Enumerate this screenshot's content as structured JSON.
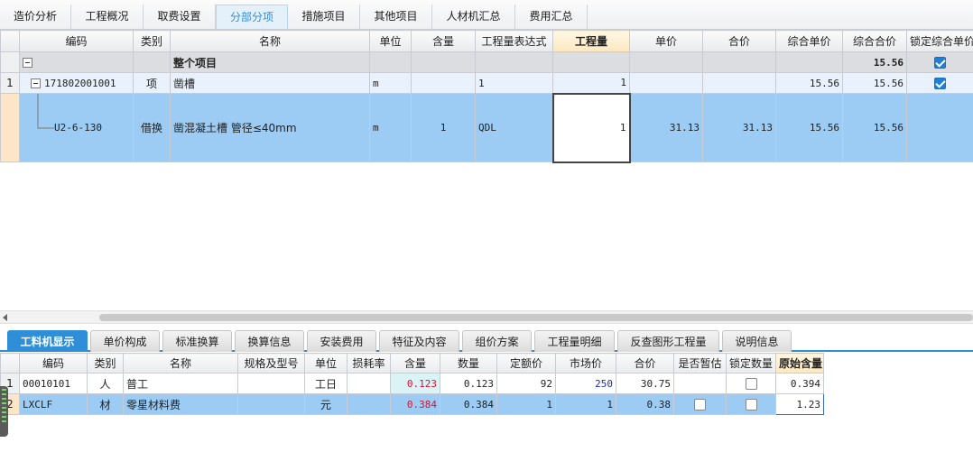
{
  "top_tabs": [
    "造价分析",
    "工程概况",
    "取费设置",
    "分部分项",
    "措施项目",
    "其他项目",
    "人材机汇总",
    "费用汇总"
  ],
  "active_top_tab": "分部分项",
  "main_grid": {
    "headers": [
      "编码",
      "类别",
      "名称",
      "单位",
      "含量",
      "工程量表达式",
      "工程量",
      "单价",
      "合价",
      "综合单价",
      "综合合价",
      "锁定综合单价"
    ],
    "rows": [
      {
        "rownum": "",
        "code": "",
        "type": "",
        "name": "整个项目",
        "unit": "",
        "content": "",
        "expr": "",
        "qty": "",
        "price": "",
        "total": "",
        "comp_price": "",
        "comp_total": "15.56",
        "locked": true
      },
      {
        "rownum": "1",
        "code": "171802001001",
        "type": "项",
        "name": "凿槽",
        "unit": "m",
        "content": "",
        "expr": "1",
        "qty": "1",
        "price": "",
        "total": "",
        "comp_price": "15.56",
        "comp_total": "15.56",
        "locked": true
      },
      {
        "rownum": "",
        "code": "U2-6-130",
        "type": "借换",
        "name": "凿混凝土槽 管径≤40mm",
        "unit": "m",
        "content": "1",
        "expr": "QDL",
        "qty": "1",
        "price": "31.13",
        "total": "31.13",
        "comp_price": "15.56",
        "comp_total": "15.56",
        "locked": false
      }
    ]
  },
  "bottom_tabs": [
    "工料机显示",
    "单价构成",
    "标准换算",
    "换算信息",
    "安装费用",
    "特征及内容",
    "组价方案",
    "工程量明细",
    "反查图形工程量",
    "说明信息"
  ],
  "active_bottom_tab": "工料机显示",
  "resource_grid": {
    "headers": [
      "编码",
      "类别",
      "名称",
      "规格及型号",
      "单位",
      "损耗率",
      "含量",
      "数量",
      "定额价",
      "市场价",
      "合价",
      "是否暂估",
      "锁定数量",
      "原始含量"
    ],
    "rows": [
      {
        "rownum": "1",
        "code": "00010101",
        "type": "人",
        "name": "普工",
        "spec": "",
        "unit": "工日",
        "loss": "",
        "content": "0.123",
        "amount": "0.123",
        "quota_price": "92",
        "market_price": "250",
        "total": "30.75",
        "provisional": "",
        "lock_qty": false,
        "orig_content": "0.394"
      },
      {
        "rownum": "2",
        "code": "LXCLF",
        "type": "材",
        "name": "零星材料费",
        "spec": "",
        "unit": "元",
        "loss": "",
        "content": "0.384",
        "amount": "0.384",
        "quota_price": "1",
        "market_price": "1",
        "total": "0.38",
        "provisional": false,
        "lock_qty": false,
        "orig_content": "1.23"
      }
    ]
  }
}
